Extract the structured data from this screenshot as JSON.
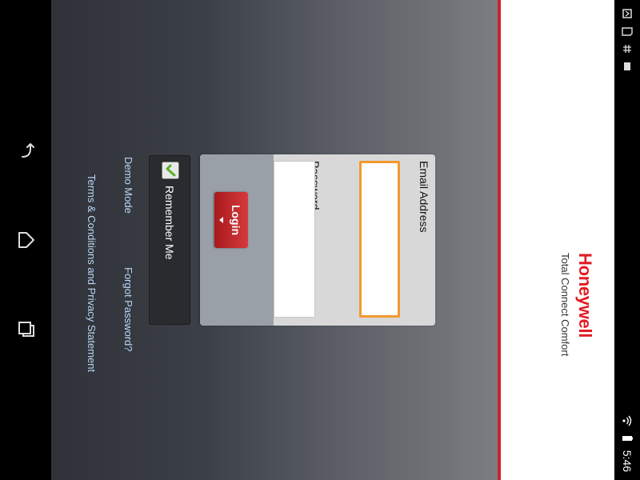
{
  "status_bar": {
    "time": "5:46",
    "left_icons": [
      "notification-icon",
      "sd-card-icon",
      "usb-icon",
      "screenshot-icon"
    ],
    "right_icons": [
      "wifi-icon",
      "battery-icon"
    ]
  },
  "header": {
    "brand": "Honeywell",
    "subtitle": "Total Connect Comfort"
  },
  "form": {
    "email_label": "Email Address",
    "email_value": "",
    "password_label": "Password",
    "password_value": "",
    "login_label": "Login",
    "remember_label": "Remember Me",
    "remember_checked": true
  },
  "links": {
    "demo_mode": "Demo Mode",
    "forgot_password": "Forgot Password?",
    "terms": "Terms & Conditions and Privacy Statement"
  },
  "nav": {
    "icons": [
      "back-icon",
      "home-icon",
      "recents-icon"
    ]
  },
  "colors": {
    "brand_red": "#e31b23",
    "focus_orange": "#f29a2e",
    "link_blue": "#b9d7f7"
  }
}
